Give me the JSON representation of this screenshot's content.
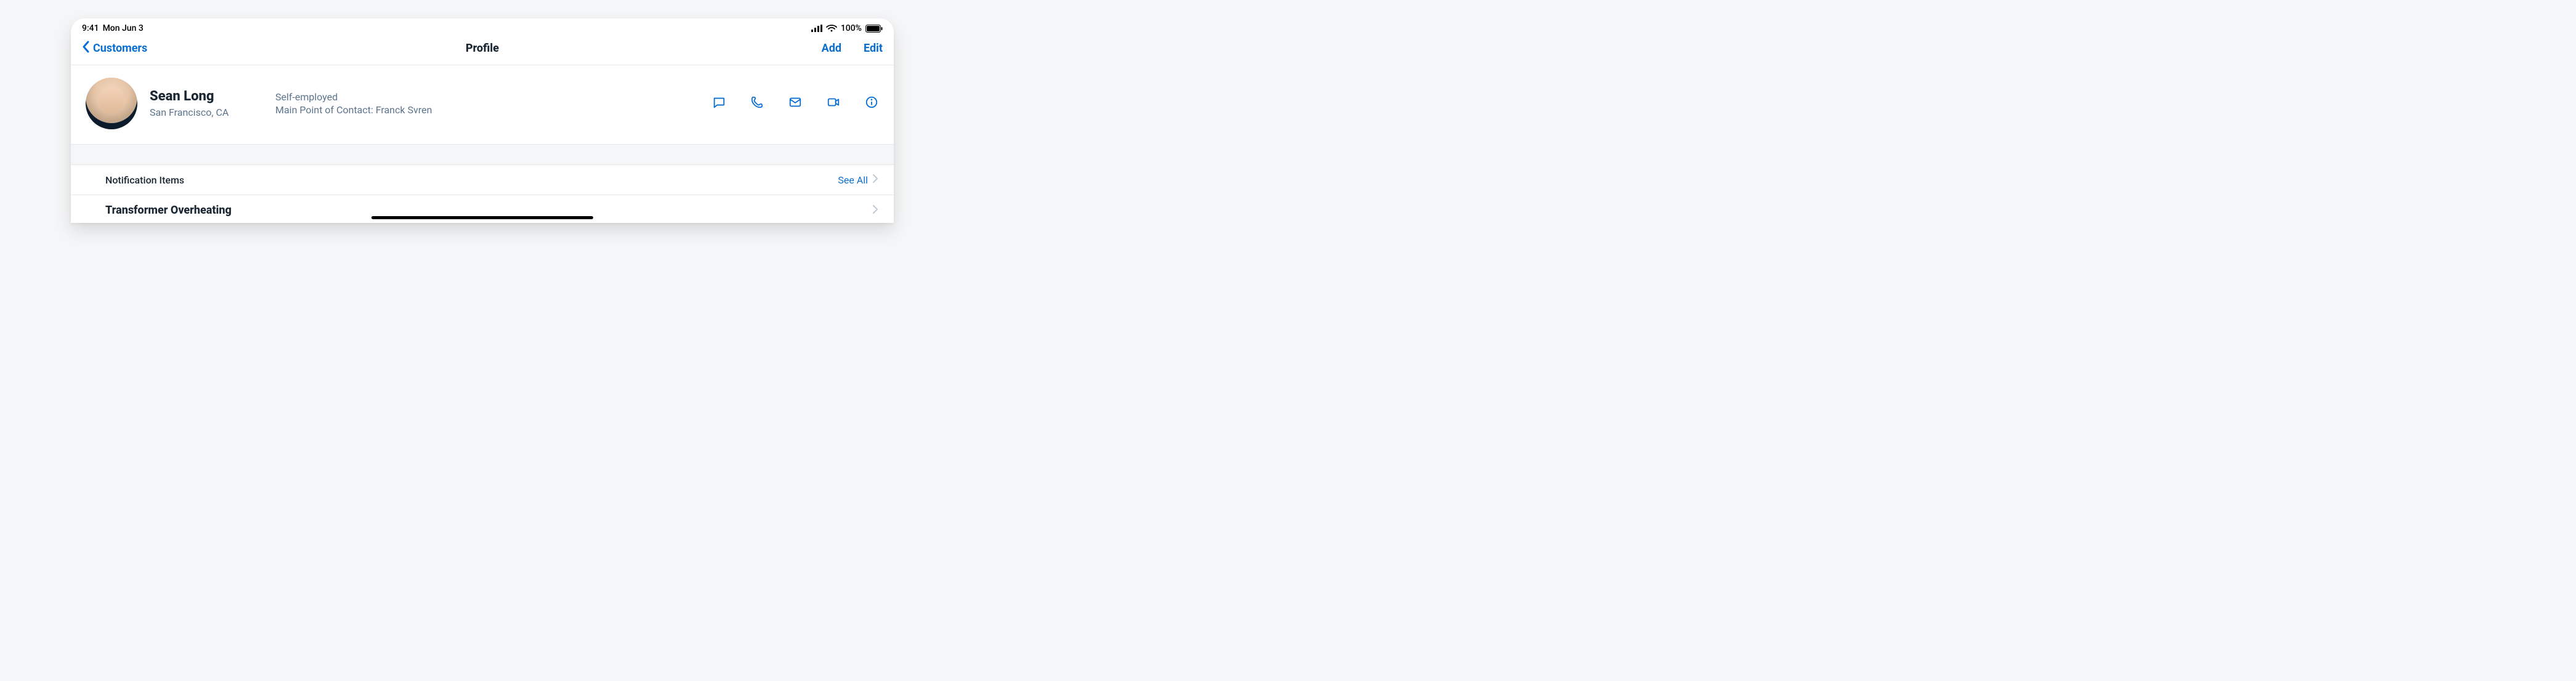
{
  "statusbar": {
    "time": "9:41",
    "date": "Mon Jun 3",
    "battery_pct": "100%"
  },
  "nav": {
    "back_label": "Customers",
    "title": "Profile",
    "add_label": "Add",
    "edit_label": "Edit"
  },
  "profile": {
    "name": "Sean Long",
    "location": "San Francisco, CA",
    "employment": "Self-employed",
    "contact_line": "Main Point of Contact: Franck Svren"
  },
  "sections": {
    "notifications_header": "Notification Items",
    "see_all_label": "See All",
    "items": [
      {
        "title": "Transformer Overheating"
      }
    ]
  }
}
